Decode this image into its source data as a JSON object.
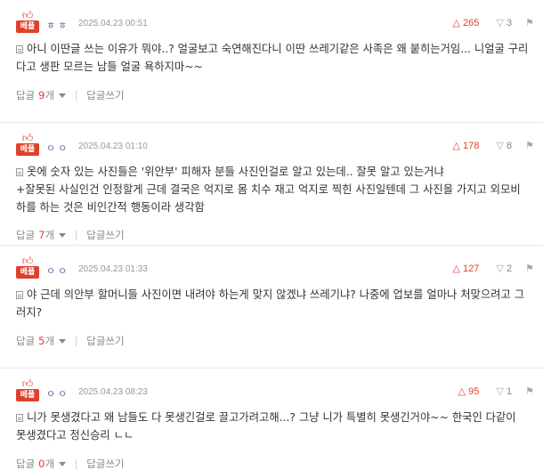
{
  "colors": {
    "accent": "#e0412c",
    "nickname": "#5a6ea0",
    "meta_gray": "#999999",
    "divider": "#e8e8e8"
  },
  "badge_label": "베플",
  "comments": [
    {
      "nickname": "ㅎㅎ",
      "date": "2025.04.23 00:51",
      "likes": "265",
      "dislikes": "3",
      "content": "아니 이딴글 쓰는 이유가 뭐야..? 얼굴보고 숙연해진다니 이딴 쓰레기같은 사족은 왜 붙히는거임... 니얼굴 구리다고 생판 모르는 남들 얼굴 욕하지마~~",
      "reply_label": "답글",
      "reply_count": "9",
      "reply_unit": "개",
      "write_reply": "답글쓰기"
    },
    {
      "nickname": "ㅇㅇ",
      "date": "2025.04.23 01:10",
      "likes": "178",
      "dislikes": "8",
      "content": "옷에 숫자 있는 사진들은 '위안부' 피해자 분들 사진인걸로 알고 있는데.. 잘못 알고 있는거냐\n+잘못된 사실인건 인정할게 근데 결국은 억지로 몸 치수 재고 억지로 찍힌 사진일텐데 그 사진을 가지고 외모비하를 하는 것은 비인간적 행동이라 생각함",
      "reply_label": "답글",
      "reply_count": "7",
      "reply_unit": "개",
      "write_reply": "답글쓰기"
    },
    {
      "nickname": "ㅇㅇ",
      "date": "2025.04.23 01:33",
      "likes": "127",
      "dislikes": "2",
      "content": "야 근데 의안부 할머니들 사진이면 내려야 하는게 맞지 않겠냐 쓰레기냐? 나중에 업보를 얼마나 처맞으려고 그러지?",
      "reply_label": "답글",
      "reply_count": "5",
      "reply_unit": "개",
      "write_reply": "답글쓰기"
    },
    {
      "nickname": "ㅇㅇ",
      "date": "2025.04.23 08:23",
      "likes": "95",
      "dislikes": "1",
      "content": "니가 못생겼다고 왜 남들도 다 못생긴걸로 끌고가려고해...? 그냥 니가 특별히 못생긴거야~~ 한국인 다같이 못생겼다고 정신승리 ㄴㄴ",
      "reply_label": "답글",
      "reply_count": "0",
      "reply_unit": "개",
      "write_reply": "답글쓰기"
    }
  ]
}
